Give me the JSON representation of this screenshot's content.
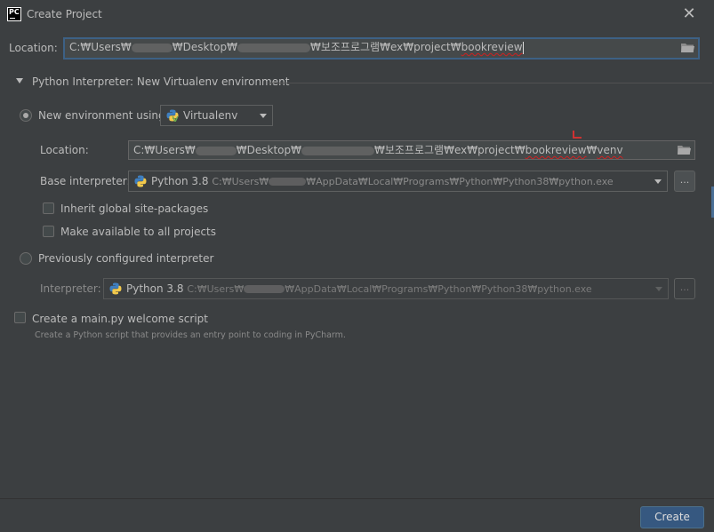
{
  "window": {
    "title": "Create Project",
    "app_icon_text": "PC"
  },
  "location": {
    "label": "Location:",
    "value_prefix": "C:₩Users₩",
    "value_mid": "₩Desktop₩",
    "value_suffix_a": "₩보조프로그램₩ex₩project₩",
    "value_suffix_b": "bookreview"
  },
  "interpreter_section": {
    "title": "Python Interpreter: New Virtualenv environment",
    "new_env": {
      "label": "New environment using",
      "tool": "Virtualenv",
      "location_label": "Location:",
      "location_prefix": "C:₩Users₩",
      "location_mid": "₩Desktop₩",
      "location_suffix_a": "₩보조프로그램₩ex₩project₩",
      "location_suffix_b": "bookreview",
      "location_suffix_c": "₩",
      "location_suffix_d": "venv",
      "base_label": "Base interpreter:",
      "base_version": "Python 3.8",
      "base_path_prefix": "C:₩Users₩",
      "base_path_suffix": "₩AppData₩Local₩Programs₩Python₩Python38₩python.exe",
      "inherit_label": "Inherit global site-packages",
      "make_available_label": "Make available to all projects",
      "dots_label": "..."
    },
    "previous": {
      "label": "Previously configured interpreter",
      "interpreter_label": "Interpreter:",
      "version": "Python 3.8",
      "path_prefix": "C:₩Users₩",
      "path_suffix": "₩AppData₩Local₩Programs₩Python₩Python38₩python.exe",
      "dots_label": "..."
    }
  },
  "welcome_script": {
    "label": "Create a main.py welcome script",
    "hint": "Create a Python script that provides an entry point to coding in PyCharm."
  },
  "footer": {
    "create_label": "Create"
  },
  "colors": {
    "background": "#3c3f41",
    "focus_border": "#3d6185",
    "primary_button": "#365880",
    "spell_error": "#d02020"
  },
  "state": {
    "selected_interpreter_option": "new_environment",
    "inherit_checked": false,
    "make_available_checked": false,
    "welcome_script_checked": false
  }
}
